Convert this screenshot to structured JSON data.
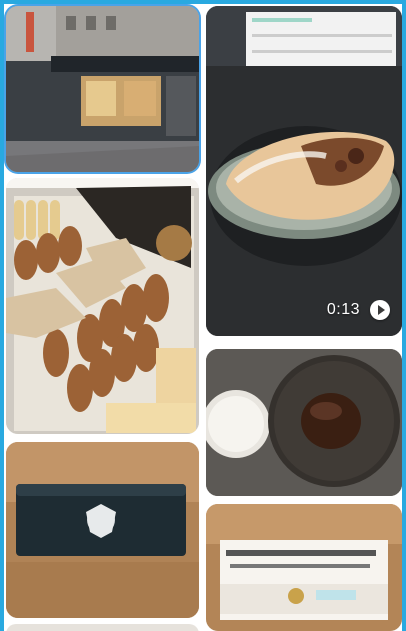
{
  "gallery": {
    "items": [
      {
        "id": "storefront",
        "kind": "photo",
        "selected": true
      },
      {
        "id": "strudel",
        "kind": "video",
        "duration": "0:13"
      },
      {
        "id": "biscuit-box",
        "kind": "photo"
      },
      {
        "id": "chocolate-cake",
        "kind": "photo"
      },
      {
        "id": "tin-box",
        "kind": "photo"
      },
      {
        "id": "label-box",
        "kind": "photo"
      }
    ]
  },
  "colors": {
    "frame_border": "#29a9e0",
    "selection": "#4aa3e8"
  }
}
